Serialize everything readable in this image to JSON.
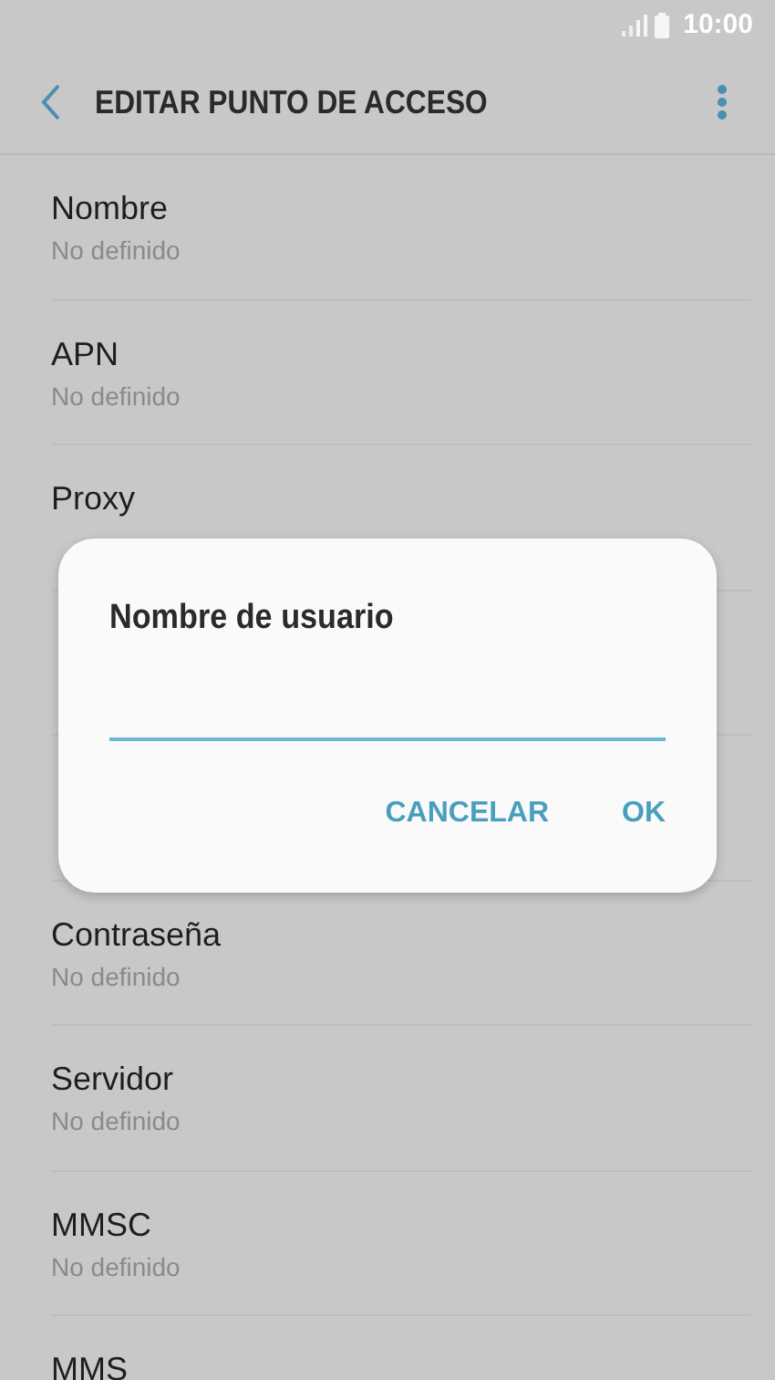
{
  "status_bar": {
    "time": "10:00"
  },
  "toolbar": {
    "title": "EDITAR PUNTO DE ACCESO"
  },
  "settings": [
    {
      "title": "Nombre",
      "subtitle": "No definido"
    },
    {
      "title": "APN",
      "subtitle": "No definido"
    },
    {
      "title": "Proxy"
    }
  ],
  "settings_below_dialog": [
    {
      "title": "Contraseña",
      "subtitle": "No definido"
    },
    {
      "title": "Servidor",
      "subtitle": "No definido"
    },
    {
      "title": "MMSC",
      "subtitle": "No definido"
    },
    {
      "title": "MMS"
    }
  ],
  "dialog": {
    "title": "Nombre de usuario",
    "buttons": [
      "CANCELAR",
      "OK"
    ]
  }
}
